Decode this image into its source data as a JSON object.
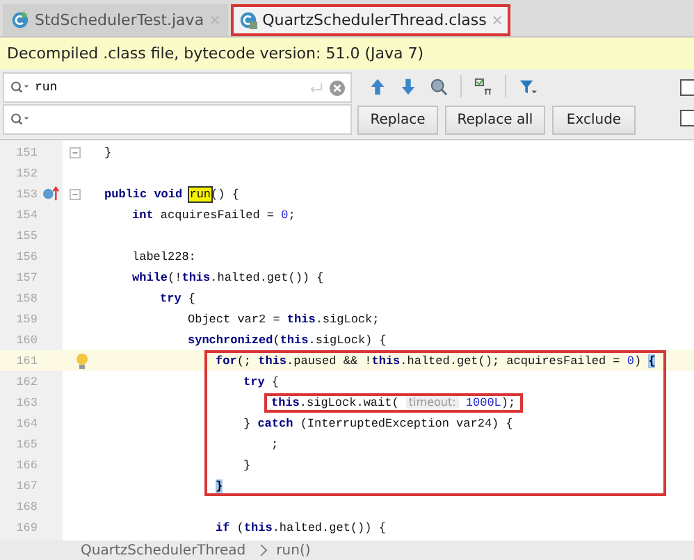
{
  "tabs": [
    {
      "label": "StdSchedulerTest.java",
      "kind": "java",
      "selected": false
    },
    {
      "label": "QuartzSchedulerThread.class",
      "kind": "class",
      "selected": true
    }
  ],
  "banner": "Decompiled .class file, bytecode version: 51.0 (Java 7)",
  "search": {
    "value": "run"
  },
  "buttons": [
    "Replace",
    "Replace all",
    "Exclude"
  ],
  "options": [
    {
      "checked": false
    },
    {
      "checked": false
    }
  ],
  "lines": [
    {
      "number": "151",
      "fold": true,
      "segs": [
        {
          "kind": "plain",
          "t": "}"
        }
      ]
    },
    {
      "number": "152"
    },
    {
      "number": "153",
      "fold": true,
      "override_marker": true,
      "segs": [
        {
          "kind": "kw",
          "t": "public void "
        },
        {
          "kind": "match",
          "t": "run"
        },
        {
          "kind": "plain",
          "t": "() {"
        }
      ],
      "children": [
        {
          "number": "154",
          "segs": [
            {
              "kind": "kw",
              "t": "int"
            },
            {
              "kind": "plain",
              "t": " acquiresFailed = "
            },
            {
              "kind": "num",
              "t": "0"
            },
            {
              "kind": "plain",
              "t": ";"
            }
          ]
        },
        {
          "number": "155"
        },
        {
          "number": "156",
          "segs": [
            {
              "kind": "plain",
              "t": "label228:"
            }
          ]
        },
        {
          "number": "157",
          "segs": [
            {
              "kind": "kw",
              "t": "while"
            },
            {
              "kind": "plain",
              "t": "(!"
            },
            {
              "kind": "kw",
              "t": "this"
            },
            {
              "kind": "plain",
              "t": ".halted.get()) {"
            }
          ],
          "children": [
            {
              "number": "158",
              "segs": [
                {
                  "kind": "kw",
                  "t": "try"
                },
                {
                  "kind": "plain",
                  "t": " {"
                }
              ],
              "children": [
                {
                  "number": "159",
                  "segs": [
                    {
                      "kind": "plain",
                      "t": "Object var2 = "
                    },
                    {
                      "kind": "kw",
                      "t": "this"
                    },
                    {
                      "kind": "plain",
                      "t": ".sigLock;"
                    }
                  ]
                },
                {
                  "number": "160",
                  "segs": [
                    {
                      "kind": "kw",
                      "t": "synchronized"
                    },
                    {
                      "kind": "plain",
                      "t": "("
                    },
                    {
                      "kind": "kw",
                      "t": "this"
                    },
                    {
                      "kind": "plain",
                      "t": ".sigLock) {"
                    }
                  ],
                  "children": [
                    {
                      "number": "161",
                      "bulb": true,
                      "current": true,
                      "framed": true,
                      "segs": [
                        {
                          "kind": "kw",
                          "t": "for"
                        },
                        {
                          "kind": "plain",
                          "t": "(; "
                        },
                        {
                          "kind": "kw",
                          "t": "this"
                        },
                        {
                          "kind": "plain",
                          "t": ".paused && !"
                        },
                        {
                          "kind": "kw",
                          "t": "this"
                        },
                        {
                          "kind": "plain",
                          "t": ".halted.get(); acquiresFailed = "
                        },
                        {
                          "kind": "num",
                          "t": "0"
                        },
                        {
                          "kind": "plain",
                          "t": ") "
                        },
                        {
                          "kind": "brace",
                          "t": "{"
                        }
                      ],
                      "children": [
                        {
                          "number": "162",
                          "segs": [
                            {
                              "kind": "kw",
                              "t": "try"
                            },
                            {
                              "kind": "plain",
                              "t": " {"
                            }
                          ],
                          "children": [
                            {
                              "number": "163",
                              "segs": [
                                {
                                  "kind": "boxed",
                                  "parts": [
                                    {
                                      "kind": "kw",
                                      "t": "this"
                                    },
                                    {
                                      "kind": "plain",
                                      "t": ".sigLock.wait( "
                                    },
                                    {
                                      "kind": "hint",
                                      "t": "timeout:"
                                    },
                                    {
                                      "kind": "num",
                                      "t": " 1000L"
                                    },
                                    {
                                      "kind": "plain",
                                      "t": ");"
                                    }
                                  ]
                                }
                              ]
                            }
                          ]
                        },
                        {
                          "number": "164",
                          "segs": [
                            {
                              "kind": "plain",
                              "t": "} "
                            },
                            {
                              "kind": "kw",
                              "t": "catch"
                            },
                            {
                              "kind": "plain",
                              "t": " (InterruptedException var24) {"
                            }
                          ],
                          "children": [
                            {
                              "number": "165",
                              "segs": [
                                {
                                  "kind": "plain",
                                  "t": ";"
                                }
                              ]
                            }
                          ]
                        },
                        {
                          "number": "166",
                          "segs": [
                            {
                              "kind": "plain",
                              "t": "}"
                            }
                          ]
                        }
                      ],
                      "end": {
                        "number": "167",
                        "segs": [
                          {
                            "kind": "brace",
                            "t": "}"
                          }
                        ]
                      }
                    },
                    {
                      "number": "168"
                    },
                    {
                      "number": "169",
                      "segs": [
                        {
                          "kind": "kw",
                          "t": "if"
                        },
                        {
                          "kind": "plain",
                          "t": " ("
                        },
                        {
                          "kind": "kw",
                          "t": "this"
                        },
                        {
                          "kind": "plain",
                          "t": ".halted.get()) {"
                        }
                      ]
                    }
                  ]
                }
              ]
            }
          ]
        }
      ]
    }
  ],
  "breadcrumb": [
    "QuartzSchedulerThread",
    "run()"
  ]
}
